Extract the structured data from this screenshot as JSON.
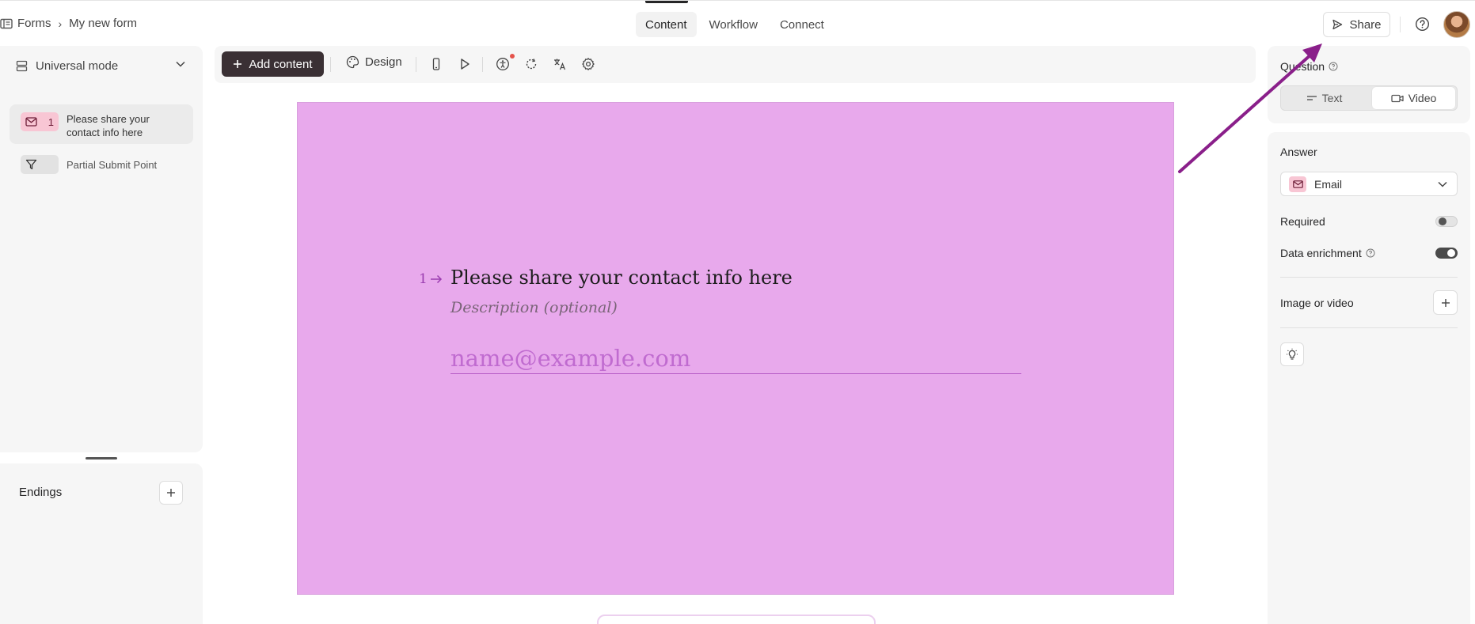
{
  "breadcrumb": {
    "root": "Forms",
    "separator": "›",
    "current": "My new form"
  },
  "top_tabs": [
    {
      "label": "Content",
      "active": true
    },
    {
      "label": "Workflow",
      "active": false
    },
    {
      "label": "Connect",
      "active": false
    }
  ],
  "header_actions": {
    "share_label": "Share"
  },
  "left_panel": {
    "mode_label": "Universal mode",
    "questions": [
      {
        "number": "1",
        "label": "Please share your contact info here",
        "icon": "mail-icon",
        "active": true
      },
      {
        "label": "Partial Submit Point",
        "icon": "funnel-icon",
        "active": false
      }
    ],
    "endings_label": "Endings"
  },
  "toolbar": {
    "add_content_label": "Add content",
    "design_label": "Design"
  },
  "canvas": {
    "background_color": "#e8a9ec",
    "question_number": "1",
    "question_title": "Please share your contact info here",
    "description_placeholder": "Description (optional)",
    "email_placeholder": "name@example.com"
  },
  "right_panel": {
    "question_label": "Question",
    "question_type_options": [
      "Text",
      "Video"
    ],
    "answer_label": "Answer",
    "answer_type": "Email",
    "required_label": "Required",
    "required_on": false,
    "data_enrichment_label": "Data enrichment",
    "data_enrichment_on": true,
    "image_video_label": "Image or video"
  },
  "colors": {
    "accent_dark": "#3a3034",
    "email_chip": "#f8c6d4",
    "annotation_arrow": "#8a1f8a"
  }
}
